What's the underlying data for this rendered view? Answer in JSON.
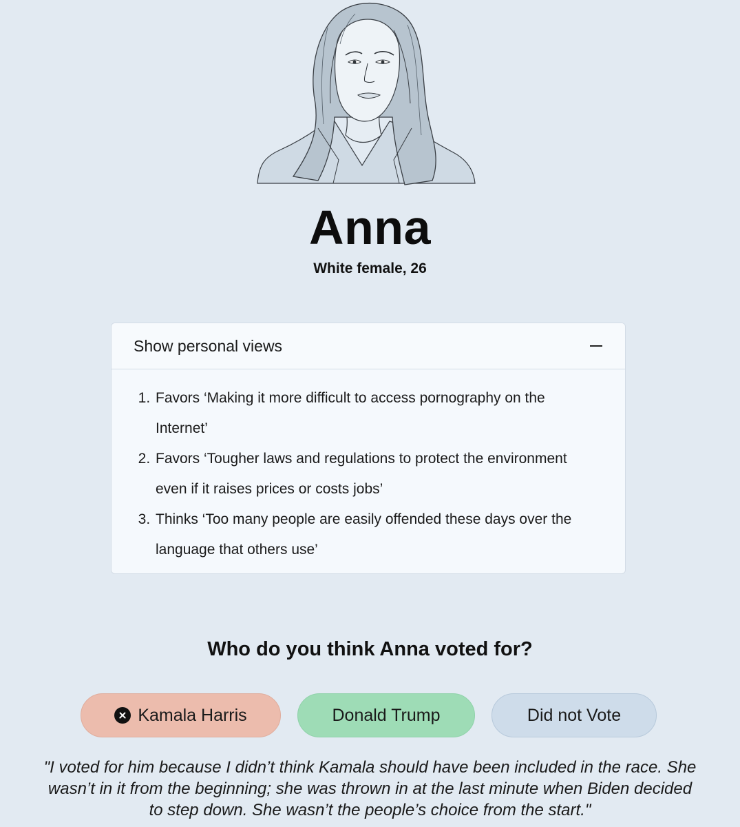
{
  "profile": {
    "name": "Anna",
    "description": "White female, 26"
  },
  "views_panel": {
    "header_label": "Show personal views",
    "toggle_icon": "minus-icon",
    "items": [
      "Favors ‘Making it more difficult to access pornography on the Internet’",
      "Favors ‘Tougher laws and regulations to protect the environment even if it raises prices or costs jobs’",
      "Thinks ‘Too many people are easily offended these days over the language that others use’"
    ]
  },
  "question": "Who do you think Anna voted for?",
  "options": {
    "harris": {
      "label": "Kamala Harris",
      "icon": "x-circle-icon",
      "color": "#ecbcad"
    },
    "trump": {
      "label": "Donald Trump",
      "color": "#9edcb6"
    },
    "novote": {
      "label": "Did not Vote",
      "color": "#cedcea"
    }
  },
  "quote": "\"I voted for him because I didn’t think Kamala should have been included in the race. She wasn’t in it from the beginning; she was thrown in at the last minute when Biden decided to step down. She wasn’t the people’s choice from the start.\""
}
